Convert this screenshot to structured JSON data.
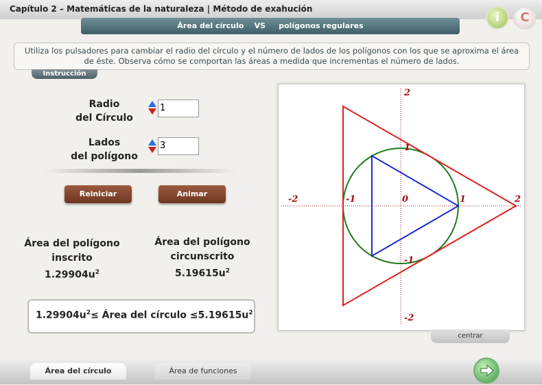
{
  "header": {
    "title": "Capítulo 2 – Matemáticas de la naturaleza | Método de exahución",
    "subtitle": "Área del círculo    VS     polígonos regulares",
    "info_label": "i",
    "c_label": "C"
  },
  "instruction": {
    "text": "Utiliza los pulsadores para cambiar el radio del círculo y el número de lados de los polígonos con los que se aproxima el área de éste. Observa cómo se comportan las áreas a medida que incrementas el número de lados.",
    "tab_label": "Instrucción"
  },
  "controls": {
    "radius_label_1": "Radio",
    "radius_label_2": "del Círculo",
    "radius_value": "1",
    "sides_label_1": "Lados",
    "sides_label_2": "del polígono",
    "sides_value": "3",
    "reset_label": "Reiniciar",
    "animate_label": "Animar"
  },
  "areas": {
    "inscribed_label_1": "Área del polígono",
    "inscribed_label_2": "inscrito",
    "inscribed_value": "1.29904u",
    "circumscribed_label_1": "Área del polígono",
    "circumscribed_label_2": "circunscrito",
    "circumscribed_value": "5.19615u",
    "unit_exponent": "2",
    "inequality_left": "1.29904u",
    "inequality_mid": "≤ Área del círculo ≤5.19615u"
  },
  "graph": {
    "axis_labels": [
      "-2",
      "-1",
      "0",
      "1",
      "2",
      "1",
      "-1",
      "2",
      "-2"
    ],
    "circle_color": "#1d7a1d",
    "inscribed_color": "#1a2bd6",
    "circumscribed_color": "#e02020",
    "axis_color": "#9a1010",
    "centrar_label": "centrar"
  },
  "footer": {
    "tab_active": "Área del círculo",
    "tab_inactive": "Área de funciones",
    "next_icon": "arrow-right-icon"
  }
}
